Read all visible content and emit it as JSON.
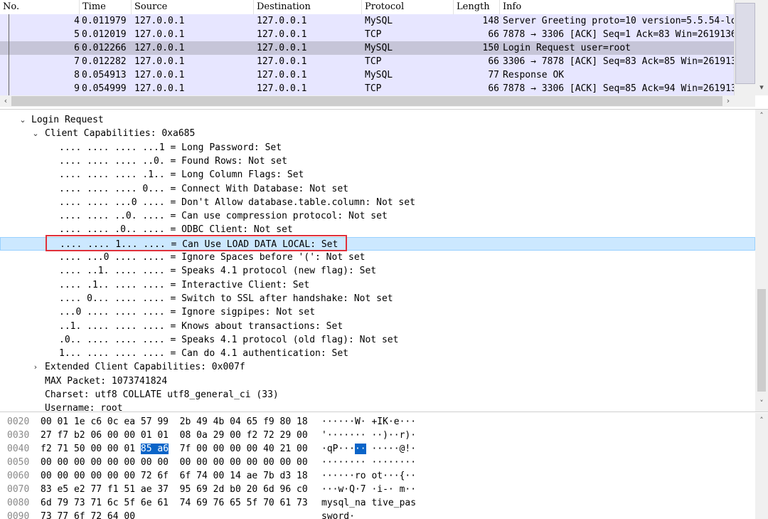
{
  "packet_list": {
    "columns": {
      "no": "No.",
      "time": "Time",
      "source": "Source",
      "destination": "Destination",
      "protocol": "Protocol",
      "length": "Length",
      "info": "Info"
    },
    "rows": [
      {
        "no": "4",
        "time": "0.011979",
        "src": "127.0.0.1",
        "dst": "127.0.0.1",
        "proto": "MySQL",
        "len": "148",
        "info": "Server Greeting proto=10 version=5.5.54-lo"
      },
      {
        "no": "5",
        "time": "0.012019",
        "src": "127.0.0.1",
        "dst": "127.0.0.1",
        "proto": "TCP",
        "len": "66",
        "info": "7878 → 3306 [ACK] Seq=1 Ack=83 Win=2619136"
      },
      {
        "no": "6",
        "time": "0.012266",
        "src": "127.0.0.1",
        "dst": "127.0.0.1",
        "proto": "MySQL",
        "len": "150",
        "info": "Login Request user=root"
      },
      {
        "no": "7",
        "time": "0.012282",
        "src": "127.0.0.1",
        "dst": "127.0.0.1",
        "proto": "TCP",
        "len": "66",
        "info": "3306 → 7878 [ACK] Seq=83 Ack=85 Win=261913"
      },
      {
        "no": "8",
        "time": "0.054913",
        "src": "127.0.0.1",
        "dst": "127.0.0.1",
        "proto": "MySQL",
        "len": "77",
        "info": "Response OK"
      },
      {
        "no": "9",
        "time": "0.054999",
        "src": "127.0.0.1",
        "dst": "127.0.0.1",
        "proto": "TCP",
        "len": "66",
        "info": "7878 → 3306 [ACK] Seq=85 Ack=94 Win=261913"
      }
    ],
    "selected_row": "6",
    "colors": {
      "row_bg": "#e7e6ff",
      "selected_bg": "#c6c5d8"
    }
  },
  "details": {
    "tree": [
      {
        "toggle": "expanded",
        "text": "Login Request"
      },
      {
        "toggle": "expanded",
        "text": "Client Capabilities: 0xa685"
      },
      {
        "text": ".... .... .... ...1 = Long Password: Set"
      },
      {
        "text": ".... .... .... ..0. = Found Rows: Not set"
      },
      {
        "text": ".... .... .... .1.. = Long Column Flags: Set"
      },
      {
        "text": ".... .... .... 0... = Connect With Database: Not set"
      },
      {
        "text": ".... .... ...0 .... = Don't Allow database.table.column: Not set"
      },
      {
        "text": ".... .... ..0. .... = Can use compression protocol: Not set"
      },
      {
        "text": ".... .... .0.. .... = ODBC Client: Not set"
      },
      {
        "text": ".... .... 1... .... = Can Use LOAD DATA LOCAL: Set"
      },
      {
        "text": ".... ...0 .... .... = Ignore Spaces before '(': Not set"
      },
      {
        "text": ".... ..1. .... .... = Speaks 4.1 protocol (new flag): Set"
      },
      {
        "text": ".... .1.. .... .... = Interactive Client: Set"
      },
      {
        "text": ".... 0... .... .... = Switch to SSL after handshake: Not set"
      },
      {
        "text": "...0 .... .... .... = Ignore sigpipes: Not set"
      },
      {
        "text": "..1. .... .... .... = Knows about transactions: Set"
      },
      {
        "text": ".0.. .... .... .... = Speaks 4.1 protocol (old flag): Not set"
      },
      {
        "text": "1... .... .... .... = Can do 4.1 authentication: Set"
      },
      {
        "toggle": "collapsed",
        "text": "Extended Client Capabilities: 0x007f"
      },
      {
        "text": "MAX Packet: 1073741824"
      },
      {
        "text": "Charset: utf8 COLLATE utf8_general_ci (33)"
      },
      {
        "text": "Username: root"
      }
    ],
    "highlighted_index": 9,
    "colors": {
      "highlight_bg": "#cce8ff",
      "annotation_box": "#e0303a"
    }
  },
  "hexdump": {
    "rows": [
      {
        "off": "0020",
        "bytes_a": "00 01 1e c6 0c ea 57 99",
        "bytes_b": "2b 49 4b 04 65 f9 80 18",
        "ascii_a": "······W·",
        "ascii_b": "+IK·e···"
      },
      {
        "off": "0030",
        "bytes_a": "27 f7 b2 06 00 00 01 01",
        "bytes_b": "08 0a 29 00 f2 72 29 00",
        "ascii_a": "'·······",
        "ascii_b": "··)··r)·"
      },
      {
        "off": "0040",
        "bytes_a": "f2 71 50 00 00 01",
        "sel_bytes": "85 a6",
        "bytes_b": "7f 00 00 00 00 40 21 00",
        "ascii_a": "·qP···",
        "sel_ascii": "··",
        "ascii_b": "·····@!·"
      },
      {
        "off": "0050",
        "bytes_a": "00 00 00 00 00 00 00 00",
        "bytes_b": "00 00 00 00 00 00 00 00",
        "ascii_a": "········",
        "ascii_b": "········"
      },
      {
        "off": "0060",
        "bytes_a": "00 00 00 00 00 00 72 6f",
        "bytes_b": "6f 74 00 14 ae 7b d3 18",
        "ascii_a": "······ro",
        "ascii_b": "ot···{··"
      },
      {
        "off": "0070",
        "bytes_a": "83 e5 e2 77 f1 51 ae 37",
        "bytes_b": "95 69 2d b0 20 6d 96 c0",
        "ascii_a": "···w·Q·7",
        "ascii_b": "·i-· m··"
      },
      {
        "off": "0080",
        "bytes_a": "6d 79 73 71 6c 5f 6e 61",
        "bytes_b": "74 69 76 65 5f 70 61 73",
        "ascii_a": "mysql_na",
        "ascii_b": "tive_pas"
      },
      {
        "off": "0090",
        "bytes_a": "73 77 6f 72 64 00",
        "bytes_b": "",
        "ascii_a": "sword·",
        "ascii_b": ""
      }
    ],
    "colors": {
      "selection_bg": "#0a64c8"
    }
  },
  "icons": {
    "expanded": "chevron-down-icon",
    "collapsed": "chevron-right-icon",
    "scroll_left": "chevron-left-icon",
    "scroll_right": "chevron-right-icon",
    "scroll_up": "chevron-up-icon",
    "scroll_down": "chevron-down-icon"
  }
}
